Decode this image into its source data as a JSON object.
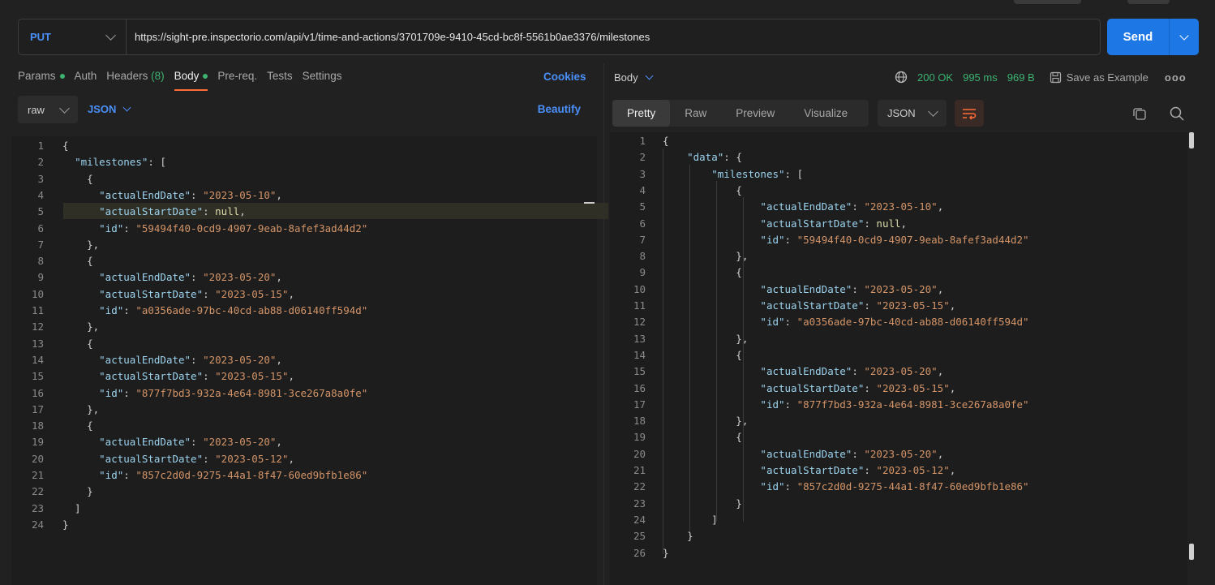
{
  "request": {
    "method": "PUT",
    "url": "https://sight-pre.inspectorio.com/api/v1/time-and-actions/3701709e-9410-45cd-bc8f-5561b0ae3376/milestones",
    "send_label": "Send"
  },
  "req_tabs": {
    "params": "Params",
    "auth": "Auth",
    "headers": "Headers",
    "headers_count": "(8)",
    "body": "Body",
    "prereq": "Pre-req.",
    "tests": "Tests",
    "settings": "Settings",
    "cookies": "Cookies"
  },
  "body_toolbar": {
    "mode": "raw",
    "format": "JSON",
    "beautify": "Beautify"
  },
  "request_body": [
    {
      "n": "1",
      "t": [
        [
          "p",
          "{"
        ]
      ]
    },
    {
      "n": "2",
      "t": [
        [
          "p",
          "  "
        ],
        [
          "k",
          "\"milestones\""
        ],
        [
          "p",
          ": ["
        ]
      ]
    },
    {
      "n": "3",
      "t": [
        [
          "p",
          "    {"
        ]
      ]
    },
    {
      "n": "4",
      "t": [
        [
          "p",
          "      "
        ],
        [
          "k",
          "\"actualEndDate\""
        ],
        [
          "p",
          ": "
        ],
        [
          "s",
          "\"2023-05-10\""
        ],
        [
          "p",
          ","
        ]
      ]
    },
    {
      "n": "5",
      "t": [
        [
          "p",
          "      "
        ],
        [
          "k",
          "\"actualStartDate\""
        ],
        [
          "p",
          ": "
        ],
        [
          "n",
          "null"
        ],
        [
          "p",
          ","
        ]
      ]
    },
    {
      "n": "6",
      "t": [
        [
          "p",
          "      "
        ],
        [
          "k",
          "\"id\""
        ],
        [
          "p",
          ": "
        ],
        [
          "s",
          "\"59494f40-0cd9-4907-9eab-8afef3ad44d2\""
        ]
      ]
    },
    {
      "n": "7",
      "t": [
        [
          "p",
          "    },"
        ]
      ]
    },
    {
      "n": "8",
      "t": [
        [
          "p",
          "    {"
        ]
      ]
    },
    {
      "n": "9",
      "t": [
        [
          "p",
          "      "
        ],
        [
          "k",
          "\"actualEndDate\""
        ],
        [
          "p",
          ": "
        ],
        [
          "s",
          "\"2023-05-20\""
        ],
        [
          "p",
          ","
        ]
      ]
    },
    {
      "n": "10",
      "t": [
        [
          "p",
          "      "
        ],
        [
          "k",
          "\"actualStartDate\""
        ],
        [
          "p",
          ": "
        ],
        [
          "s",
          "\"2023-05-15\""
        ],
        [
          "p",
          ","
        ]
      ]
    },
    {
      "n": "11",
      "t": [
        [
          "p",
          "      "
        ],
        [
          "k",
          "\"id\""
        ],
        [
          "p",
          ": "
        ],
        [
          "s",
          "\"a0356ade-97bc-40cd-ab88-d06140ff594d\""
        ]
      ]
    },
    {
      "n": "12",
      "t": [
        [
          "p",
          "    },"
        ]
      ]
    },
    {
      "n": "13",
      "t": [
        [
          "p",
          "    {"
        ]
      ]
    },
    {
      "n": "14",
      "t": [
        [
          "p",
          "      "
        ],
        [
          "k",
          "\"actualEndDate\""
        ],
        [
          "p",
          ": "
        ],
        [
          "s",
          "\"2023-05-20\""
        ],
        [
          "p",
          ","
        ]
      ]
    },
    {
      "n": "15",
      "t": [
        [
          "p",
          "      "
        ],
        [
          "k",
          "\"actualStartDate\""
        ],
        [
          "p",
          ": "
        ],
        [
          "s",
          "\"2023-05-15\""
        ],
        [
          "p",
          ","
        ]
      ]
    },
    {
      "n": "16",
      "t": [
        [
          "p",
          "      "
        ],
        [
          "k",
          "\"id\""
        ],
        [
          "p",
          ": "
        ],
        [
          "s",
          "\"877f7bd3-932a-4e64-8981-3ce267a8a0fe\""
        ]
      ]
    },
    {
      "n": "17",
      "t": [
        [
          "p",
          "    },"
        ]
      ]
    },
    {
      "n": "18",
      "t": [
        [
          "p",
          "    {"
        ]
      ]
    },
    {
      "n": "19",
      "t": [
        [
          "p",
          "      "
        ],
        [
          "k",
          "\"actualEndDate\""
        ],
        [
          "p",
          ": "
        ],
        [
          "s",
          "\"2023-05-20\""
        ],
        [
          "p",
          ","
        ]
      ]
    },
    {
      "n": "20",
      "t": [
        [
          "p",
          "      "
        ],
        [
          "k",
          "\"actualStartDate\""
        ],
        [
          "p",
          ": "
        ],
        [
          "s",
          "\"2023-05-12\""
        ],
        [
          "p",
          ","
        ]
      ]
    },
    {
      "n": "21",
      "t": [
        [
          "p",
          "      "
        ],
        [
          "k",
          "\"id\""
        ],
        [
          "p",
          ": "
        ],
        [
          "s",
          "\"857c2d0d-9275-44a1-8f47-60ed9bfb1e86\""
        ]
      ]
    },
    {
      "n": "22",
      "t": [
        [
          "p",
          "    }"
        ]
      ]
    },
    {
      "n": "23",
      "t": [
        [
          "p",
          "  ]"
        ]
      ]
    },
    {
      "n": "24",
      "t": [
        [
          "p",
          "}"
        ]
      ]
    }
  ],
  "response_header": {
    "body_label": "Body",
    "status": "200 OK",
    "time": "995 ms",
    "size": "969 B",
    "save_example": "Save as Example",
    "more": "ooo"
  },
  "response_toolbar": {
    "tabs": [
      "Pretty",
      "Raw",
      "Preview",
      "Visualize"
    ],
    "format": "JSON"
  },
  "response_body": [
    {
      "n": "1",
      "t": [
        [
          "p",
          "{"
        ]
      ]
    },
    {
      "n": "2",
      "t": [
        [
          "p",
          "    "
        ],
        [
          "k",
          "\"data\""
        ],
        [
          "p",
          ": {"
        ]
      ]
    },
    {
      "n": "3",
      "t": [
        [
          "p",
          "        "
        ],
        [
          "k",
          "\"milestones\""
        ],
        [
          "p",
          ": ["
        ]
      ]
    },
    {
      "n": "4",
      "t": [
        [
          "p",
          "            {"
        ]
      ]
    },
    {
      "n": "5",
      "t": [
        [
          "p",
          "                "
        ],
        [
          "k",
          "\"actualEndDate\""
        ],
        [
          "p",
          ": "
        ],
        [
          "s",
          "\"2023-05-10\""
        ],
        [
          "p",
          ","
        ]
      ]
    },
    {
      "n": "6",
      "t": [
        [
          "p",
          "                "
        ],
        [
          "k",
          "\"actualStartDate\""
        ],
        [
          "p",
          ": "
        ],
        [
          "n",
          "null"
        ],
        [
          "p",
          ","
        ]
      ]
    },
    {
      "n": "7",
      "t": [
        [
          "p",
          "                "
        ],
        [
          "k",
          "\"id\""
        ],
        [
          "p",
          ": "
        ],
        [
          "s",
          "\"59494f40-0cd9-4907-9eab-8afef3ad44d2\""
        ]
      ]
    },
    {
      "n": "8",
      "t": [
        [
          "p",
          "            },"
        ]
      ]
    },
    {
      "n": "9",
      "t": [
        [
          "p",
          "            {"
        ]
      ]
    },
    {
      "n": "10",
      "t": [
        [
          "p",
          "                "
        ],
        [
          "k",
          "\"actualEndDate\""
        ],
        [
          "p",
          ": "
        ],
        [
          "s",
          "\"2023-05-20\""
        ],
        [
          "p",
          ","
        ]
      ]
    },
    {
      "n": "11",
      "t": [
        [
          "p",
          "                "
        ],
        [
          "k",
          "\"actualStartDate\""
        ],
        [
          "p",
          ": "
        ],
        [
          "s",
          "\"2023-05-15\""
        ],
        [
          "p",
          ","
        ]
      ]
    },
    {
      "n": "12",
      "t": [
        [
          "p",
          "                "
        ],
        [
          "k",
          "\"id\""
        ],
        [
          "p",
          ": "
        ],
        [
          "s",
          "\"a0356ade-97bc-40cd-ab88-d06140ff594d\""
        ]
      ]
    },
    {
      "n": "13",
      "t": [
        [
          "p",
          "            },"
        ]
      ]
    },
    {
      "n": "14",
      "t": [
        [
          "p",
          "            {"
        ]
      ]
    },
    {
      "n": "15",
      "t": [
        [
          "p",
          "                "
        ],
        [
          "k",
          "\"actualEndDate\""
        ],
        [
          "p",
          ": "
        ],
        [
          "s",
          "\"2023-05-20\""
        ],
        [
          "p",
          ","
        ]
      ]
    },
    {
      "n": "16",
      "t": [
        [
          "p",
          "                "
        ],
        [
          "k",
          "\"actualStartDate\""
        ],
        [
          "p",
          ": "
        ],
        [
          "s",
          "\"2023-05-15\""
        ],
        [
          "p",
          ","
        ]
      ]
    },
    {
      "n": "17",
      "t": [
        [
          "p",
          "                "
        ],
        [
          "k",
          "\"id\""
        ],
        [
          "p",
          ": "
        ],
        [
          "s",
          "\"877f7bd3-932a-4e64-8981-3ce267a8a0fe\""
        ]
      ]
    },
    {
      "n": "18",
      "t": [
        [
          "p",
          "            },"
        ]
      ]
    },
    {
      "n": "19",
      "t": [
        [
          "p",
          "            {"
        ]
      ]
    },
    {
      "n": "20",
      "t": [
        [
          "p",
          "                "
        ],
        [
          "k",
          "\"actualEndDate\""
        ],
        [
          "p",
          ": "
        ],
        [
          "s",
          "\"2023-05-20\""
        ],
        [
          "p",
          ","
        ]
      ]
    },
    {
      "n": "21",
      "t": [
        [
          "p",
          "                "
        ],
        [
          "k",
          "\"actualStartDate\""
        ],
        [
          "p",
          ": "
        ],
        [
          "s",
          "\"2023-05-12\""
        ],
        [
          "p",
          ","
        ]
      ]
    },
    {
      "n": "22",
      "t": [
        [
          "p",
          "                "
        ],
        [
          "k",
          "\"id\""
        ],
        [
          "p",
          ": "
        ],
        [
          "s",
          "\"857c2d0d-9275-44a1-8f47-60ed9bfb1e86\""
        ]
      ]
    },
    {
      "n": "23",
      "t": [
        [
          "p",
          "            }"
        ]
      ]
    },
    {
      "n": "24",
      "t": [
        [
          "p",
          "        ]"
        ]
      ]
    },
    {
      "n": "25",
      "t": [
        [
          "p",
          "    }"
        ]
      ]
    },
    {
      "n": "26",
      "t": [
        [
          "p",
          "}"
        ]
      ]
    }
  ],
  "colors": {
    "accent": "#1d78e6",
    "method": "#4a8ff7",
    "ok": "#3cb371",
    "active_tab": "#ff6c37",
    "json_key": "#9cd3ee",
    "json_string": "#d39468"
  }
}
